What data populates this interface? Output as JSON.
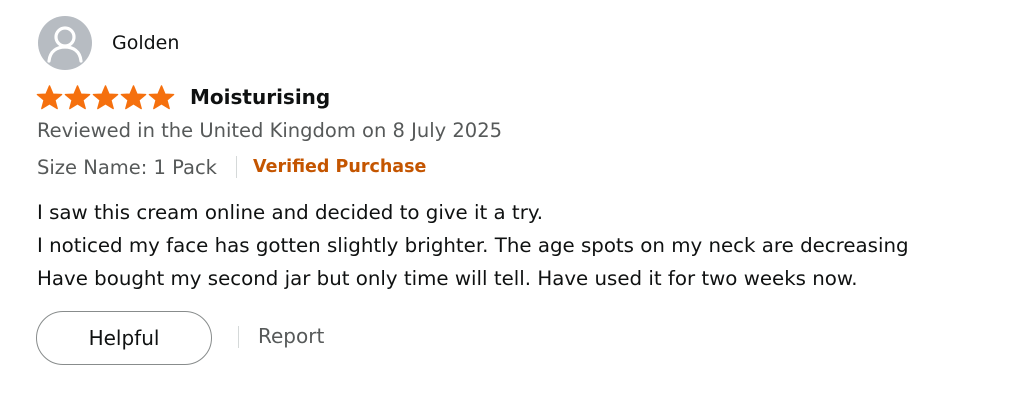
{
  "review": {
    "reviewer_name": "Golden",
    "avatar_icon": "default-user-avatar-icon",
    "rating": 5,
    "rating_max": 5,
    "star_color": "#f5700e",
    "title": "Moisturising",
    "date_line": "Reviewed in the United Kingdom on 8 July 2025",
    "size_name": "Size Name: 1 Pack",
    "verified_label": "Verified Purchase",
    "verified_color": "#c45500",
    "body_lines": [
      "I saw this cream online and decided to give it a try.",
      "I noticed my face has gotten slightly brighter. The age spots on my neck are decreasing",
      "Have bought my second jar but only time will tell. Have used it for two weeks now."
    ]
  },
  "actions": {
    "helpful_label": "Helpful",
    "report_label": "Report"
  }
}
